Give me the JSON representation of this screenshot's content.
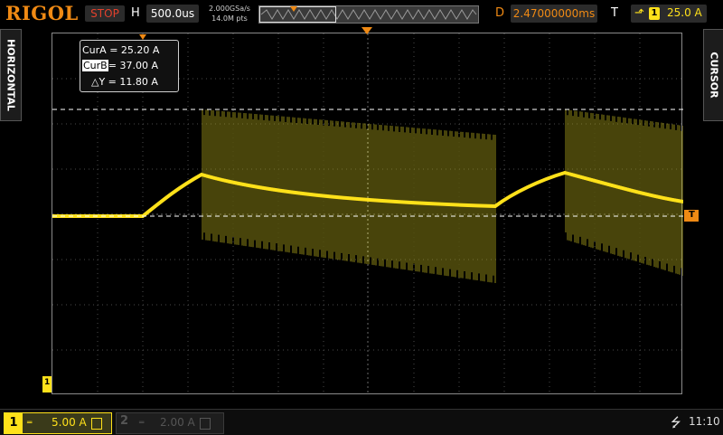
{
  "header": {
    "brand": "RIGOL",
    "run_state": "STOP",
    "h_label": "H",
    "timebase": "500.0us",
    "sample_rate": "2.000GSa/s",
    "memory_depth": "14.0M pts",
    "d_label": "D",
    "delay": "2.47000000ms",
    "t_label": "T",
    "trigger_edge_icon": "rising-edge-icon",
    "trigger_channel": "1",
    "trigger_level": "25.0 A"
  },
  "side_tabs": {
    "left": "HORIZONTAL",
    "right": "CURSOR"
  },
  "cursor": {
    "cur_a_label": "CurA =",
    "cur_a_value": "25.20 A",
    "cur_b_label": "CurB",
    "cur_b_sep": "=",
    "cur_b_value": "37.00 A",
    "delta_label": "△Y =",
    "delta_value": "11.80 A"
  },
  "markers": {
    "trigger_level_tag": "T",
    "ch1_ground_tag": "1"
  },
  "bottom": {
    "ch1_num": "1",
    "ch1_coupling_icon": "dc-coupling-icon",
    "ch1_scale": "5.00 A",
    "ch2_num": "2",
    "ch2_scale": "2.00 A",
    "usb_icon": "usb-icon",
    "time": "11:10"
  },
  "colors": {
    "ch1": "#ffe11a",
    "accent": "#f08a14",
    "stop": "#e2412c"
  }
}
